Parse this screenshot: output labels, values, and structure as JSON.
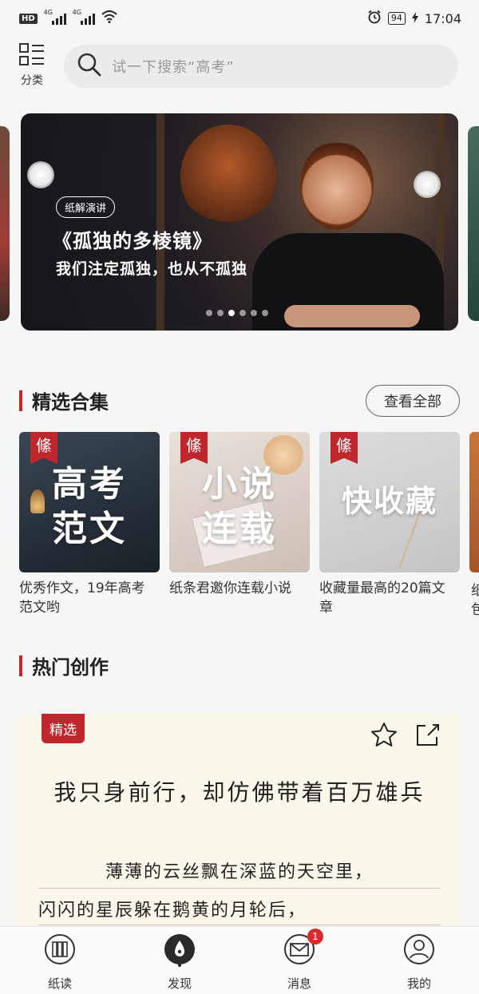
{
  "status_bar": {
    "hd": "HD",
    "signal1_label": "4G",
    "signal2_label": "4G",
    "battery": "94",
    "time": "17:04"
  },
  "header": {
    "category_label": "分类",
    "search_placeholder": "试一下搜索“高考”"
  },
  "banner": {
    "tag": "纸解演讲",
    "title": "《孤独的多棱镜》",
    "subtitle": "我们注定孤独，也从不孤独",
    "dots_total": 6,
    "dots_active_index": 2
  },
  "featured": {
    "section_title": "精选合集",
    "see_all": "查看全部",
    "ribbon_char": "絛",
    "cards": [
      {
        "cover_line1": "高考",
        "cover_line2": "范文",
        "desc": "优秀作文，19年高考范文哟"
      },
      {
        "cover_line1": "小说",
        "cover_line2": "连载",
        "desc": "纸条君邀你连载小说"
      },
      {
        "cover_line1": "快收藏",
        "cover_line2": "",
        "desc": "收藏量最高的20篇文章"
      }
    ],
    "peek_desc": "纸包"
  },
  "hot": {
    "section_title": "热门创作",
    "tag": "精选",
    "title": "我只身前行，却仿佛带着百万雄兵",
    "lines": [
      "薄薄的云丝飘在深蓝的天空里，",
      "闪闪的星辰躲在鹅黄的月轮后，"
    ]
  },
  "bottom_nav": {
    "items": [
      {
        "label": "纸读",
        "icon": "book-icon"
      },
      {
        "label": "发现",
        "icon": "compass-icon"
      },
      {
        "label": "消息",
        "icon": "mail-icon"
      },
      {
        "label": "我的",
        "icon": "user-icon"
      }
    ],
    "message_badge": "1",
    "active_index": 1
  },
  "colors": {
    "accent_red": "#c0272d",
    "background": "#f7f6f6",
    "hot_card_bg": "#fbf7ea"
  }
}
